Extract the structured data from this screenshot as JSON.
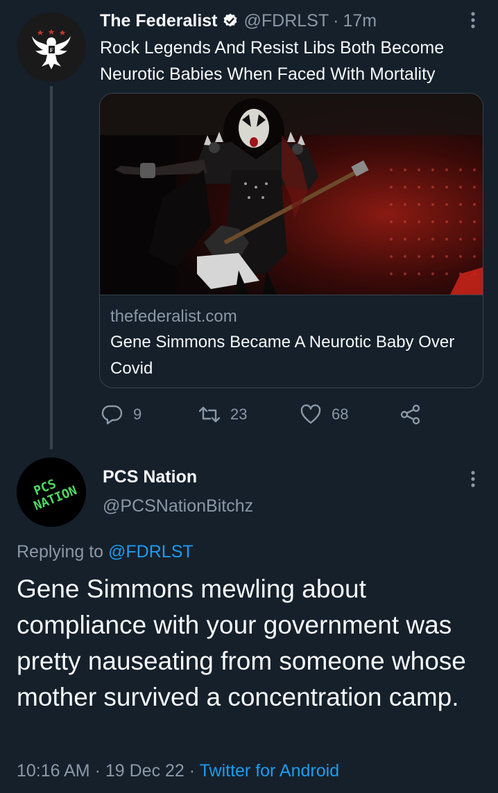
{
  "tweet1": {
    "display_name": "The Federalist",
    "handle": "@FDRLST",
    "separator": "·",
    "time": "17m",
    "text": "Rock Legends And Resist Libs Both Become Neurotic Babies When Faced With Mortality",
    "verified": true,
    "avatar_icon": "eagle-logo-icon",
    "card": {
      "image_icon": "rock-performer-photo",
      "domain": "thefederalist.com",
      "title": "Gene Simmons Became A Neurotic Baby Over Covid"
    },
    "actions": {
      "replies": "9",
      "retweets": "23",
      "likes": "68"
    }
  },
  "tweet2": {
    "display_name": "PCS Nation",
    "handle": "@PCSNationBitchz",
    "avatar_text_line1": "PCS",
    "avatar_text_line2": "NATION",
    "replying_prefix": "Replying to",
    "replying_to": "@FDRLST",
    "body": "Gene Simmons mewling about compliance with your government was pretty nauseating from someone whose mother survived a concentration camp.",
    "time": "10:16 AM",
    "date": "19 Dec 22",
    "separator": "·",
    "source": "Twitter for Android"
  },
  "colors": {
    "background": "#15202b",
    "text_primary": "#f7f9f9",
    "text_secondary": "#8b98a5",
    "accent": "#1d9bf0",
    "border": "#38444d",
    "avatar2_text": "#4cd964"
  }
}
